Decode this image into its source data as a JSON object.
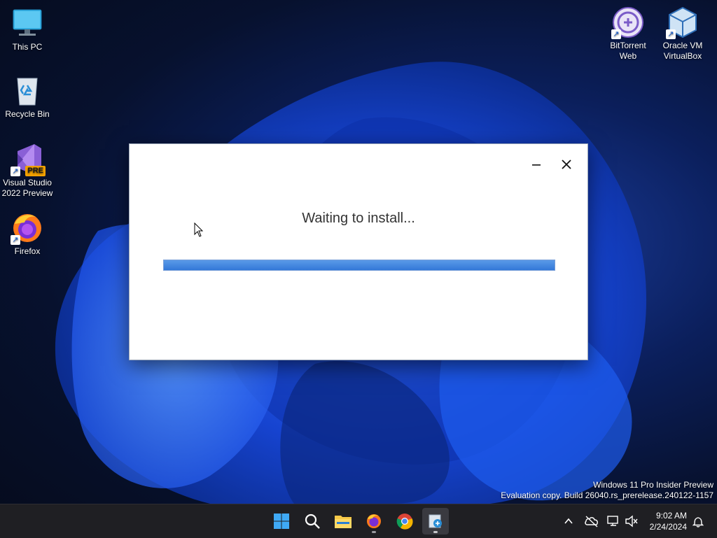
{
  "desktop": {
    "icons_left": [
      {
        "label": "This PC",
        "icon": "monitor-icon"
      },
      {
        "label": "Recycle Bin",
        "icon": "recycle-bin-icon"
      },
      {
        "label": "Visual Studio 2022 Preview",
        "icon": "visual-studio-icon",
        "badge": "PRE"
      },
      {
        "label": "Firefox",
        "icon": "firefox-icon"
      }
    ],
    "icons_right": [
      {
        "label": "BitTorrent Web",
        "icon": "bittorrent-icon"
      },
      {
        "label": "Oracle VM VirtualBox",
        "icon": "virtualbox-icon"
      }
    ]
  },
  "dialog": {
    "status_text": "Waiting to install...",
    "progress_percent": 100,
    "minimize_icon": "minimize-icon",
    "close_icon": "close-icon"
  },
  "watermark": {
    "line1": "Windows 11 Pro Insider Preview",
    "line2": "Evaluation copy. Build 26040.rs_prerelease.240122-1157"
  },
  "taskbar": {
    "apps": [
      "start-icon",
      "search-icon",
      "file-explorer-icon",
      "firefox-icon",
      "chrome-icon",
      "installer-icon"
    ],
    "clock_time": "9:02 AM",
    "clock_date": "2/24/2024"
  },
  "colors": {
    "accent": "#3378d8",
    "taskbar_bg": "#1f1f23"
  }
}
